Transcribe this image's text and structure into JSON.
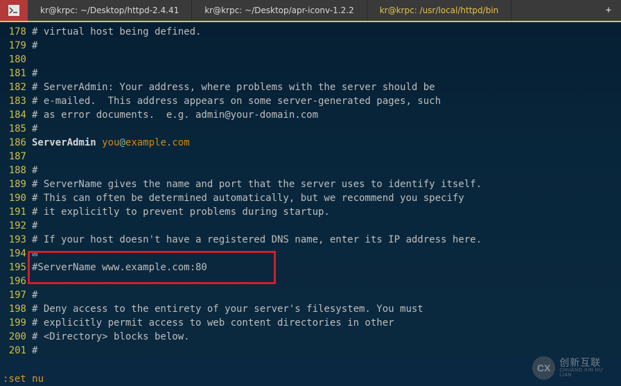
{
  "tabs": {
    "items": [
      {
        "label": "kr@krpc: ~/Desktop/httpd-2.4.41"
      },
      {
        "label": "kr@krpc: ~/Desktop/apr-iconv-1.2.2"
      },
      {
        "label": "kr@krpc: /usr/local/httpd/bin"
      }
    ],
    "active_index": 2,
    "plus": "+"
  },
  "gutter_start": 178,
  "code_lines": [
    "# virtual host being defined.",
    "#",
    "",
    "#",
    "# ServerAdmin: Your address, where problems with the server should be",
    "# e-mailed.  This address appears on some server-generated pages, such",
    "# as error documents.  e.g. admin@your-domain.com",
    "#",
    "__SERVERADMIN__",
    "",
    "#",
    "# ServerName gives the name and port that the server uses to identify itself.",
    "# This can often be determined automatically, but we recommend you specify",
    "# it explicitly to prevent problems during startup.",
    "#",
    "# If your host doesn't have a registered DNS name, enter its IP address here.",
    "__BOXCHAR__",
    "#ServerName www.example.com:80",
    "",
    "#",
    "# Deny access to the entirety of your server's filesystem. You must",
    "# explicitly permit access to web content directories in other",
    "# <Directory> blocks below.",
    "#"
  ],
  "serveradmin": {
    "directive": "ServerAdmin",
    "value_local": "you",
    "value_at": "@",
    "value_domain": "example",
    "value_dot": ".",
    "value_tld": "com"
  },
  "box_char": "⊠",
  "status_line": ":set nu",
  "highlight_line_index": 17,
  "logo": {
    "mark": "CX",
    "main": "创新互联",
    "sub": "CHUANG XIN HU LIAN"
  }
}
